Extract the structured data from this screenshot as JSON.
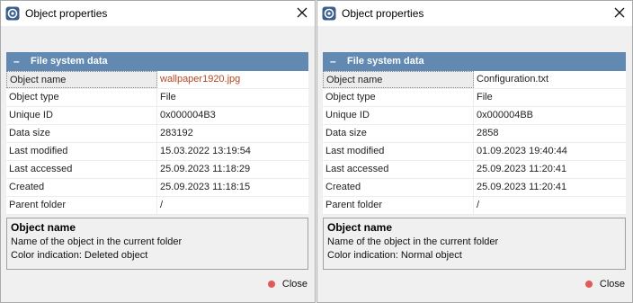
{
  "dialogs": [
    {
      "title": "Object properties",
      "group_title": "File system data",
      "group_toggle": "–",
      "rows": [
        {
          "key": "Object name",
          "value": "wallpaper1920.jpg"
        },
        {
          "key": "Object type",
          "value": "File"
        },
        {
          "key": "Unique ID",
          "value": "0x000004B3"
        },
        {
          "key": "Data size",
          "value": "283192"
        },
        {
          "key": "Last modified",
          "value": "15.03.2022 13:19:54"
        },
        {
          "key": "Last accessed",
          "value": "25.09.2023 11:18:29"
        },
        {
          "key": "Created",
          "value": "25.09.2023 11:18:15"
        },
        {
          "key": "Parent folder",
          "value": "/"
        }
      ],
      "description": {
        "title": "Object name",
        "line1": "Name of the object in the current folder",
        "line2": "Color indication: Deleted object"
      },
      "close_label": "Close",
      "name_color": "#b5461e"
    },
    {
      "title": "Object properties",
      "group_title": "File system data",
      "group_toggle": "–",
      "rows": [
        {
          "key": "Object name",
          "value": "Configuration.txt"
        },
        {
          "key": "Object type",
          "value": "File"
        },
        {
          "key": "Unique ID",
          "value": "0x000004BB"
        },
        {
          "key": "Data size",
          "value": "2858"
        },
        {
          "key": "Last modified",
          "value": "01.09.2023 19:40:44"
        },
        {
          "key": "Last accessed",
          "value": "25.09.2023 11:20:41"
        },
        {
          "key": "Created",
          "value": "25.09.2023 11:20:41"
        },
        {
          "key": "Parent folder",
          "value": "/"
        }
      ],
      "description": {
        "title": "Object name",
        "line1": "Name of the object in the current folder",
        "line2": "Color indication: Normal object"
      },
      "close_label": "Close",
      "name_color": "#222222"
    }
  ],
  "colors": {
    "group_header": "#6189b1",
    "close_dot": "#e05a5a"
  },
  "icons": {
    "app": "app-logo-icon",
    "close": "close-icon",
    "close_button": "red-dot-icon"
  }
}
